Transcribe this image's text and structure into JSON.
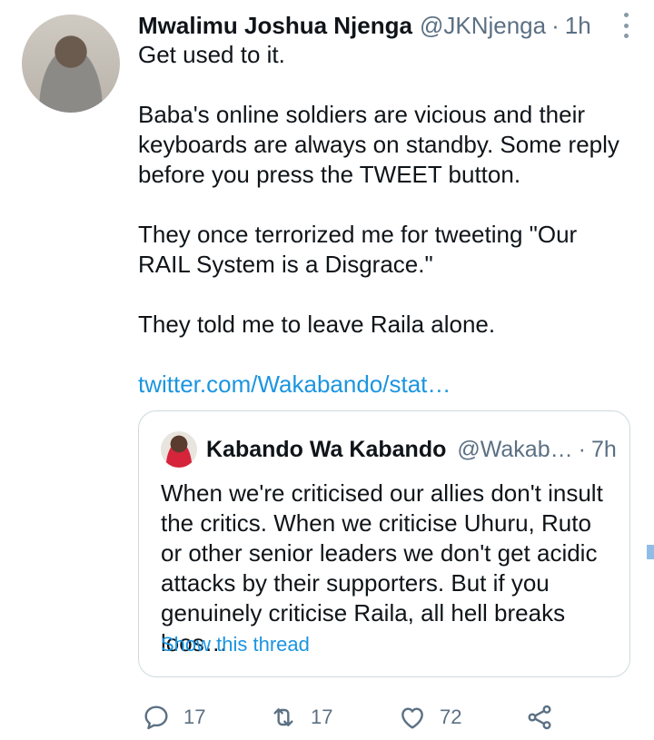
{
  "tweet": {
    "author_name": "Mwalimu Joshua Njenga",
    "author_handle": "@JKNjenga",
    "separator": "·",
    "time": "1h",
    "paragraphs": [
      "Get used to it.",
      "Baba's online soldiers are vicious and their keyboards are always on standby. Some reply before you press the TWEET button.",
      "They once terrorized me for tweeting \"Our RAIL System is a Disgrace.\"",
      "They told me to leave Raila alone."
    ],
    "link": "twitter.com/Wakabando/stat…"
  },
  "quoted_tweet": {
    "author_name": "Kabando Wa Kabando",
    "author_handle": "@Wakab…",
    "separator": "·",
    "time": "7h",
    "text": "When we're criticised our allies don't insult the critics. When we criticise Uhuru, Ruto or other senior leaders we don't get acidic attacks by their supporters. But if you genuinely criticise Raila, all hell breaks loos…",
    "show_thread": "Show this thread"
  },
  "actions": {
    "reply_count": "17",
    "retweet_count": "17",
    "like_count": "72"
  },
  "colors": {
    "text": "#0f1419",
    "secondary": "#5b7083",
    "link": "#1b95e0",
    "border": "#cfd9de",
    "verified": "#1da1f2"
  },
  "icons": [
    "more-icon",
    "verified-icon",
    "reply-icon",
    "retweet-icon",
    "like-icon",
    "share-icon"
  ]
}
